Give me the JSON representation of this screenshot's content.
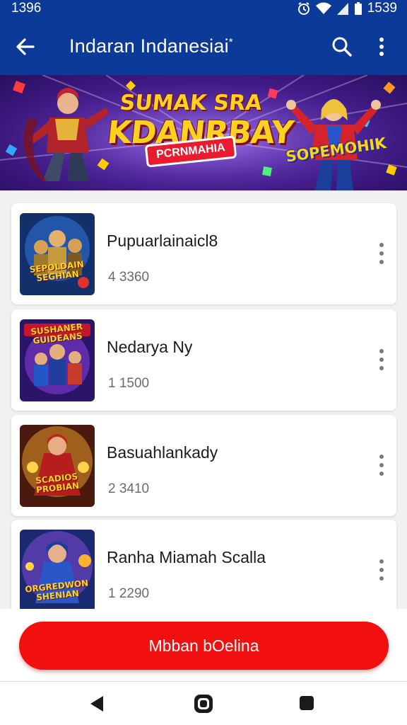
{
  "status_bar": {
    "time_left": "1396",
    "time_right": "1539"
  },
  "app_bar": {
    "title": "Indaran Indanesiai",
    "title_mark": "*",
    "back_icon": "arrow-left-icon",
    "search_icon": "search-icon",
    "more_icon": "more-vert-icon"
  },
  "banner": {
    "headline_line1": "SUMAK SRA",
    "headline_line2": "KDANRBAY",
    "ribbon": "PCRNMAHIA",
    "right_logo": "SOPEMOHIK"
  },
  "games": [
    {
      "name": "Pupuarlainaicl8",
      "count": "4 3360",
      "thumb_caption": "SEPOLDAIN SEGHIAN",
      "thumb_style": "gold-heroes"
    },
    {
      "name": "Nedarya Ny",
      "count": "1 1500",
      "thumb_caption": "SUSHANER GUIDEANS",
      "thumb_style": "purple-squad"
    },
    {
      "name": "Basuahlankady",
      "count": "2 3410",
      "thumb_caption": "SCADIOS PROBIAN",
      "thumb_style": "red-warrior"
    },
    {
      "name": "Ranha Miamah Scalla",
      "count": "1 2290",
      "thumb_caption": "ORGREDWON SHENIAN",
      "thumb_style": "blue-knight"
    }
  ],
  "bottom": {
    "button_label": "Mbban bOelina"
  },
  "colors": {
    "app_bar": "#0b3a98",
    "primary_button": "#f10f0f",
    "background": "#f1f1f3"
  }
}
